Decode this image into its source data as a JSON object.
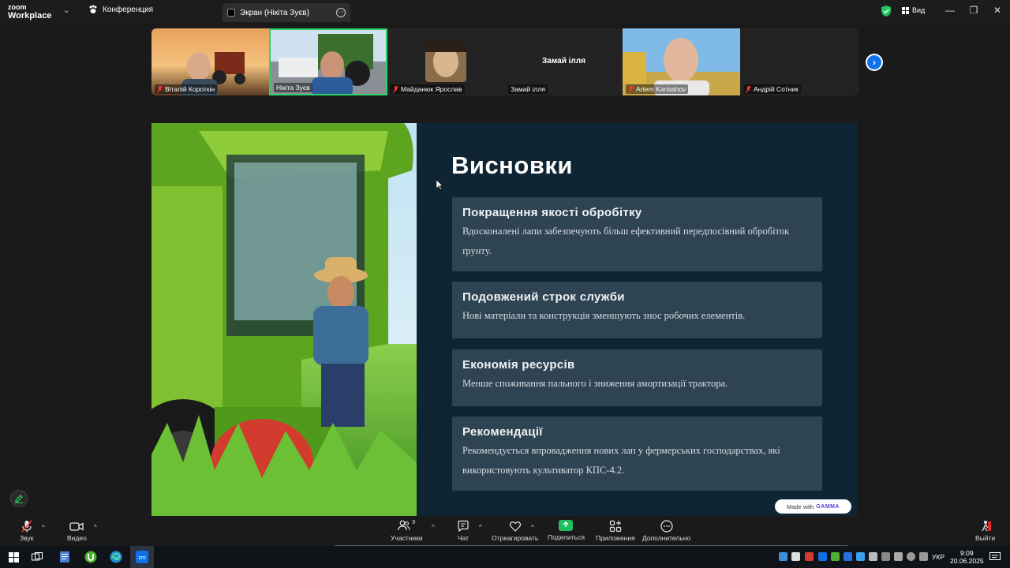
{
  "app": {
    "logo_line1": "zoom",
    "logo_line2": "Workplace",
    "tab_conference": "Конференция",
    "tab_screen": "Экран (Нікіта Зуєв)",
    "view_label": "Вид"
  },
  "participants": [
    {
      "name": "Віталій Короткін",
      "muted": true
    },
    {
      "name": "Нікіта Зуєв",
      "muted": false,
      "active": true
    },
    {
      "name": "Майданюк Ярослав",
      "muted": true
    },
    {
      "name": "Замай ілля",
      "display_name": "Замай ілля",
      "muted": false
    },
    {
      "name": "Artem Kartashov",
      "muted": true
    },
    {
      "name": "Андрій Сотник",
      "muted": true
    }
  ],
  "slide": {
    "title": "Висновки",
    "cards": [
      {
        "heading": "Покращення якості обробітку",
        "text": "Вдосконалені лапи забезпечують більш ефективний передпосівний обробіток ґрунту."
      },
      {
        "heading": "Подовжений строк служби",
        "text": "Нові матеріали та конструкція зменшують знос робочих елементів."
      },
      {
        "heading": "Економія ресурсів",
        "text": "Менше споживання пального і зниження амортизації трактора."
      },
      {
        "heading": "Рекомендації",
        "text": "Рекомендується впровадження нових лап у фермерських господарствах, які використовують культиватор КПС-4.2."
      }
    ],
    "made_with": "Made with",
    "made_with_brand": "GAMMA"
  },
  "toolbar": {
    "audio": "Звук",
    "video": "Видео",
    "participants": "Участники",
    "participants_count": "9",
    "chat": "Чат",
    "react": "Отреагировать",
    "share": "Поделиться",
    "apps": "Приложения",
    "more": "Дополнительно",
    "leave": "Выйти"
  },
  "taskbar": {
    "lang": "УКР",
    "time": "9:09",
    "date": "20.06.2025"
  },
  "colors": {
    "active_border": "#2dd46a",
    "share_green": "#1fbe5f",
    "slide_bg": "#0f2533",
    "card_bg": "#2f4452",
    "zoom_blue": "#0e72ed"
  }
}
